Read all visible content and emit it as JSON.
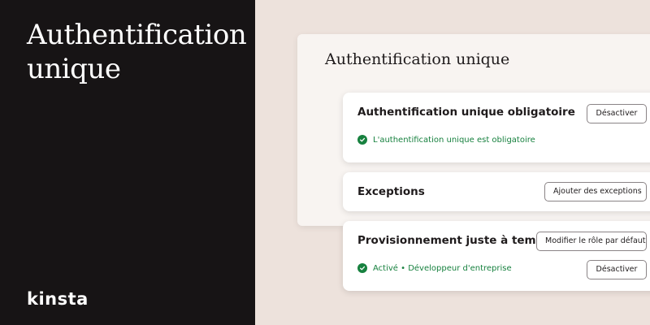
{
  "hero": {
    "title": "Authentification unique"
  },
  "brand": {
    "logo": "kinsta"
  },
  "panel": {
    "title": "Authentification unique"
  },
  "cards": [
    {
      "title": "Authentification unique obligatoire",
      "button": "Désactiver",
      "status": "L'authentification unique est obligatoire",
      "status_icon": "check-circle-icon"
    },
    {
      "title": "Exceptions",
      "button": "Ajouter des exceptions"
    },
    {
      "title": "Provisionnement juste à temps",
      "button": "Modifier le rôle par défaut",
      "status": "Activé • Développeur d'entreprise",
      "status_icon": "check-circle-icon",
      "secondary_button": "Désactiver"
    }
  ],
  "colors": {
    "left_background": "#171415",
    "right_background": "#ede2dc",
    "panel_background": "#f8f4f1",
    "success": "#17813f"
  }
}
